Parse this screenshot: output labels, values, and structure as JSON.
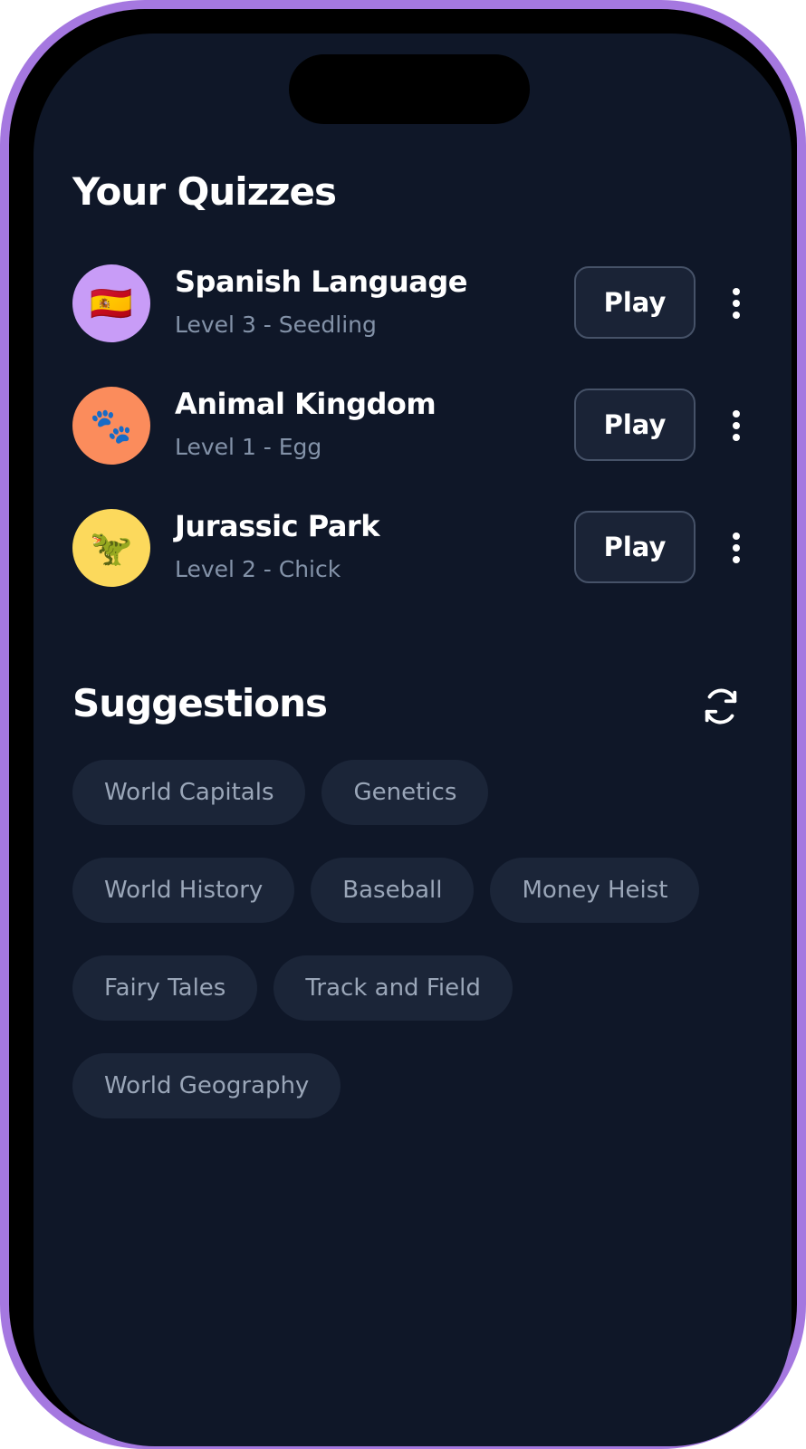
{
  "quizzes": {
    "heading": "Your Quizzes",
    "items": [
      {
        "title": "Spanish Language",
        "level": "Level 3 - Seedling",
        "icon": "🇪🇸",
        "icon_name": "spain-flag-icon",
        "color": "#c89cf7",
        "play_label": "Play"
      },
      {
        "title": "Animal Kingdom",
        "level": "Level 1 - Egg",
        "icon": "🐾",
        "icon_name": "paw-prints-icon",
        "color": "#fb8c5c",
        "play_label": "Play"
      },
      {
        "title": "Jurassic Park",
        "level": "Level 2 - Chick",
        "icon": "🦖",
        "icon_name": "t-rex-icon",
        "color": "#fcd95c",
        "play_label": "Play"
      }
    ]
  },
  "suggestions": {
    "heading": "Suggestions",
    "refresh_icon": "refresh-icon",
    "chips": [
      "World Capitals",
      "Genetics",
      "World History",
      "Baseball",
      "Money Heist",
      "Fairy Tales",
      "Track and Field",
      "World Geography"
    ]
  },
  "colors": {
    "background": "#0f1728",
    "frame": "#a578e0",
    "chip": "#1b2538"
  }
}
